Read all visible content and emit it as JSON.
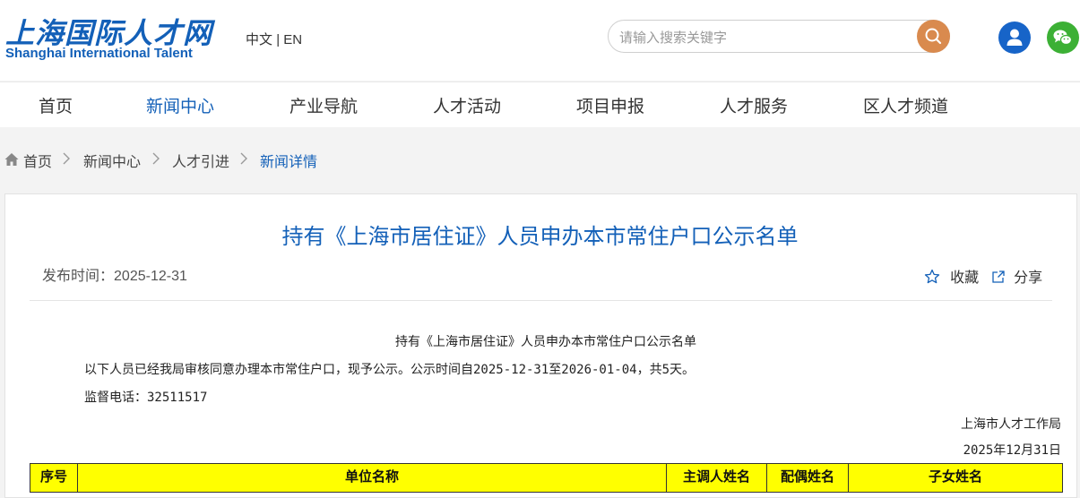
{
  "header": {
    "logo_cn": "上海国际人才网",
    "logo_en": "Shanghai International Talent",
    "lang_cn": "中文",
    "lang_sep": "|",
    "lang_en": "EN",
    "search_placeholder": "请输入搜索关键字"
  },
  "nav": {
    "items": [
      "首页",
      "新闻中心",
      "产业导航",
      "人才活动",
      "项目申报",
      "人才服务",
      "区人才频道"
    ],
    "active": "新闻中心"
  },
  "breadcrumb": [
    "首页",
    "新闻中心",
    "人才引进",
    "新闻详情"
  ],
  "article": {
    "title": "持有《上海市居住证》人员申办本市常住户口公示名单",
    "publish_label": "发布时间：",
    "publish_date": "2025-12-31",
    "favorite_label": "收藏",
    "share_label": "分享",
    "heading": "持有《上海市居住证》人员申办本市常住户口公示名单",
    "notice": "以下人员已经我局审核同意办理本市常住户口，现予公示。公示时间自2025-12-31至2026-01-04，共5天。",
    "phone": "监督电话：32511517",
    "issuer": "上海市人才工作局",
    "date": "2025年12月31日"
  },
  "table": {
    "headers": [
      "序号",
      "单位名称",
      "主调人姓名",
      "配偶姓名",
      "子女姓名"
    ]
  },
  "colors": {
    "brand_blue": "#1360b8",
    "search_orange": "#d98a4e",
    "user_blue": "#1764c8",
    "wechat_green": "#3cb035",
    "table_header_bg": "#ffff00"
  },
  "icons": [
    "search-icon",
    "user-icon",
    "wechat-icon",
    "home-icon",
    "chevron-right-icon",
    "star-icon",
    "share-icon"
  ]
}
